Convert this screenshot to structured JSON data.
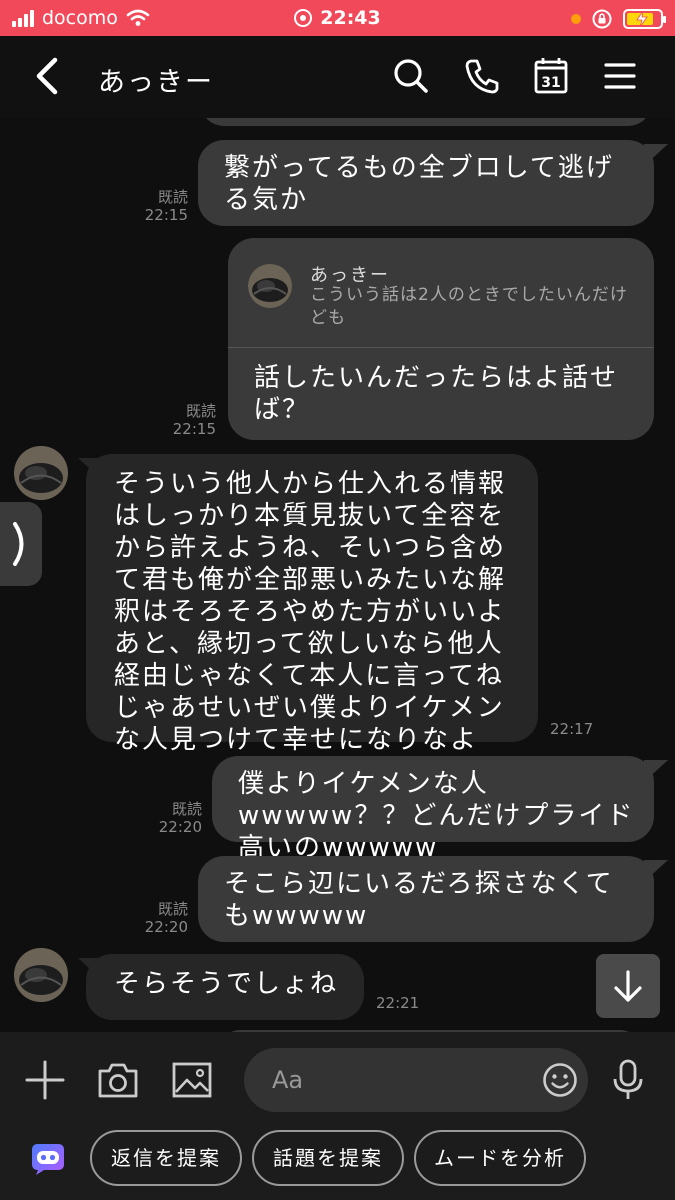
{
  "status_bar": {
    "carrier": "docomo",
    "time": "22:43"
  },
  "header": {
    "contact_name": "あっきー"
  },
  "messages": [
    {
      "direction": "out",
      "text": "繋がってるもの全ブロして逃げる気か",
      "read": "既読",
      "time": "22:15"
    },
    {
      "direction": "out",
      "quoted_name": "あっきー",
      "quoted_text": "こういう話は2人のときでしたいんだけども",
      "text": "話したいんだったらはよ話せば？",
      "read": "既読",
      "time": "22:15"
    },
    {
      "direction": "in",
      "text": "そういう他人から仕入れる情報はしっかり本質見抜いて全容をから許えようね、そいつら含めて君も俺が全部悪いみたいな解釈はそろそろやめた方がいいよあと、縁切って欲しいなら他人経由じゃなくて本人に言ってねじゃあせいぜい僕よりイケメンな人見つけて幸せになりなよ",
      "time": "22:17"
    },
    {
      "direction": "out",
      "text": "僕よりイケメンな人wwwww？？どんだけプライド高いのwwwww",
      "read": "既読",
      "time": "22:20"
    },
    {
      "direction": "out",
      "text": "そこら辺にいるだろ探さなくてもwwwww",
      "read": "既読",
      "time": "22:20"
    },
    {
      "direction": "in",
      "text": "そらそうでしょね",
      "time": "22:21"
    }
  ],
  "input": {
    "placeholder": "Aa"
  },
  "suggestions": [
    "返信を提案",
    "話題を提案",
    "ムードを分析"
  ],
  "colors": {
    "status_bar_bg": "#f2495a",
    "background": "#0f0f0f",
    "outgoing_bubble": "#3a3a3a",
    "incoming_bubble": "#262626"
  }
}
